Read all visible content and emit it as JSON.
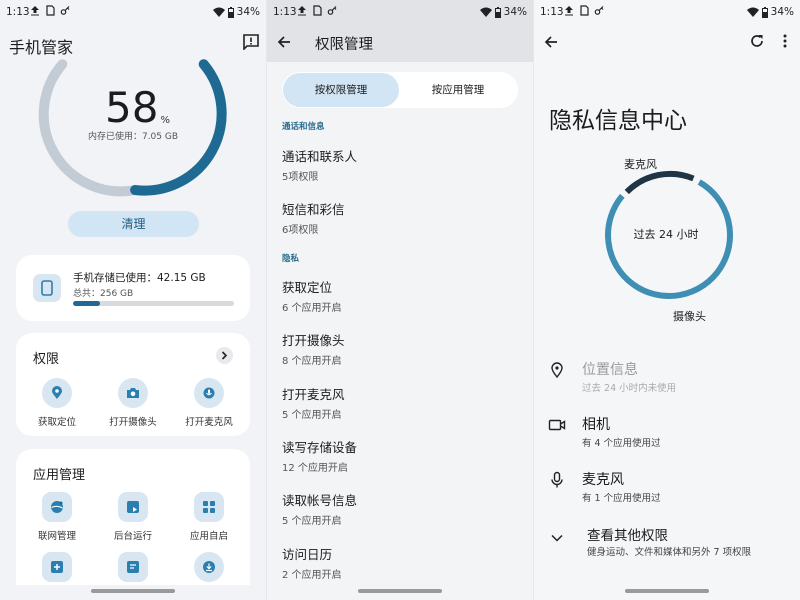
{
  "status": {
    "time": "1:13",
    "battery": "34%"
  },
  "panel1": {
    "title": "手机管家",
    "memory_percent": "58",
    "percent_sign": "%",
    "memory_used": "内存已使用：7.05 GB",
    "clean_button": "清理",
    "storage": {
      "used": "手机存储已使用：42.15 GB",
      "total": "总共：256 GB",
      "fraction": 0.165
    },
    "permissions": {
      "title": "权限",
      "items": [
        {
          "label": "获取定位",
          "icon": "location-icon"
        },
        {
          "label": "打开摄像头",
          "icon": "camera-icon"
        },
        {
          "label": "打开麦克风",
          "icon": "mic-icon"
        }
      ]
    },
    "apps": {
      "title": "应用管理",
      "items": [
        {
          "label": "联网管理",
          "icon": "globe-icon"
        },
        {
          "label": "后台运行",
          "icon": "background-run-icon"
        },
        {
          "label": "应用自启",
          "icon": "grid-icon"
        }
      ]
    }
  },
  "panel2": {
    "title": "权限管理",
    "tab_active": "按权限管理",
    "tab_inactive": "按应用管理",
    "cat1": "通话和信息",
    "cat2": "隐私",
    "items1": [
      {
        "title": "通话和联系人",
        "sub": "5项权限"
      },
      {
        "title": "短信和彩信",
        "sub": "6项权限"
      }
    ],
    "items2": [
      {
        "title": "获取定位",
        "sub": "6 个应用开启"
      },
      {
        "title": "打开摄像头",
        "sub": "8 个应用开启"
      },
      {
        "title": "打开麦克风",
        "sub": "5 个应用开启"
      },
      {
        "title": "读写存储设备",
        "sub": "12 个应用开启"
      },
      {
        "title": "读取帐号信息",
        "sub": "5 个应用开启"
      },
      {
        "title": "访问日历",
        "sub": "2 个应用开启"
      }
    ]
  },
  "panel3": {
    "title": "隐私信息中心",
    "label_top": "麦克风",
    "label_bottom": "摄像头",
    "center_text": "过去 24 小时",
    "items": [
      {
        "title": "位置信息",
        "sub": "过去 24 小时内未使用",
        "icon": "location-pin-icon"
      },
      {
        "title": "相机",
        "sub": "有 4 个应用使用过",
        "icon": "videocam-icon"
      },
      {
        "title": "麦克风",
        "sub": "有 1 个应用使用过",
        "icon": "mic-icon"
      },
      {
        "title": "查看其他权限",
        "sub": "健身运动、文件和媒体和另外 7 项权限",
        "icon": "chevron-down-icon"
      }
    ]
  },
  "colors": {
    "accent": "#1e6a92",
    "ring_track": "#c3ccd5",
    "pill": "#d2e5f5",
    "ring_blue": "#3f8fb5",
    "ring_dark": "#1f3444"
  }
}
